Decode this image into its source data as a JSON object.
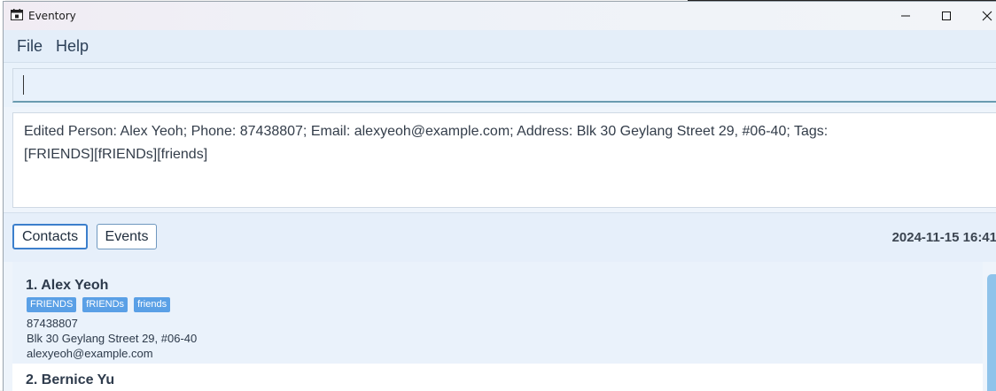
{
  "window": {
    "title": "Eventory"
  },
  "menu": {
    "file": "File",
    "help": "Help"
  },
  "command": {
    "value": ""
  },
  "result": {
    "text": "Edited Person: Alex Yeoh; Phone: 87438807; Email: alexyeoh@example.com; Address: Blk 30 Geylang Street 29, #06-40; Tags:\n[FRIENDS][fRIENDs][friends]"
  },
  "tabs": {
    "contacts": "Contacts",
    "events": "Events"
  },
  "datetime": "2024-11-15 16:41",
  "contacts": [
    {
      "name": "1. Alex Yeoh",
      "tags": [
        "FRIENDS",
        "fRIENDs",
        "friends"
      ],
      "phone": "87438807",
      "address": "Blk 30 Geylang Street 29, #06-40",
      "email": "alexyeoh@example.com"
    },
    {
      "name": "2. Bernice Yu"
    }
  ],
  "colors": {
    "accent": "#3c7fcc",
    "tag": "#5aa0e6",
    "scrollbar": "#8fc3ea"
  },
  "icons": {
    "app": "calendar-icon",
    "minimize": "minimize-icon",
    "maximize": "maximize-icon",
    "close": "close-icon"
  }
}
